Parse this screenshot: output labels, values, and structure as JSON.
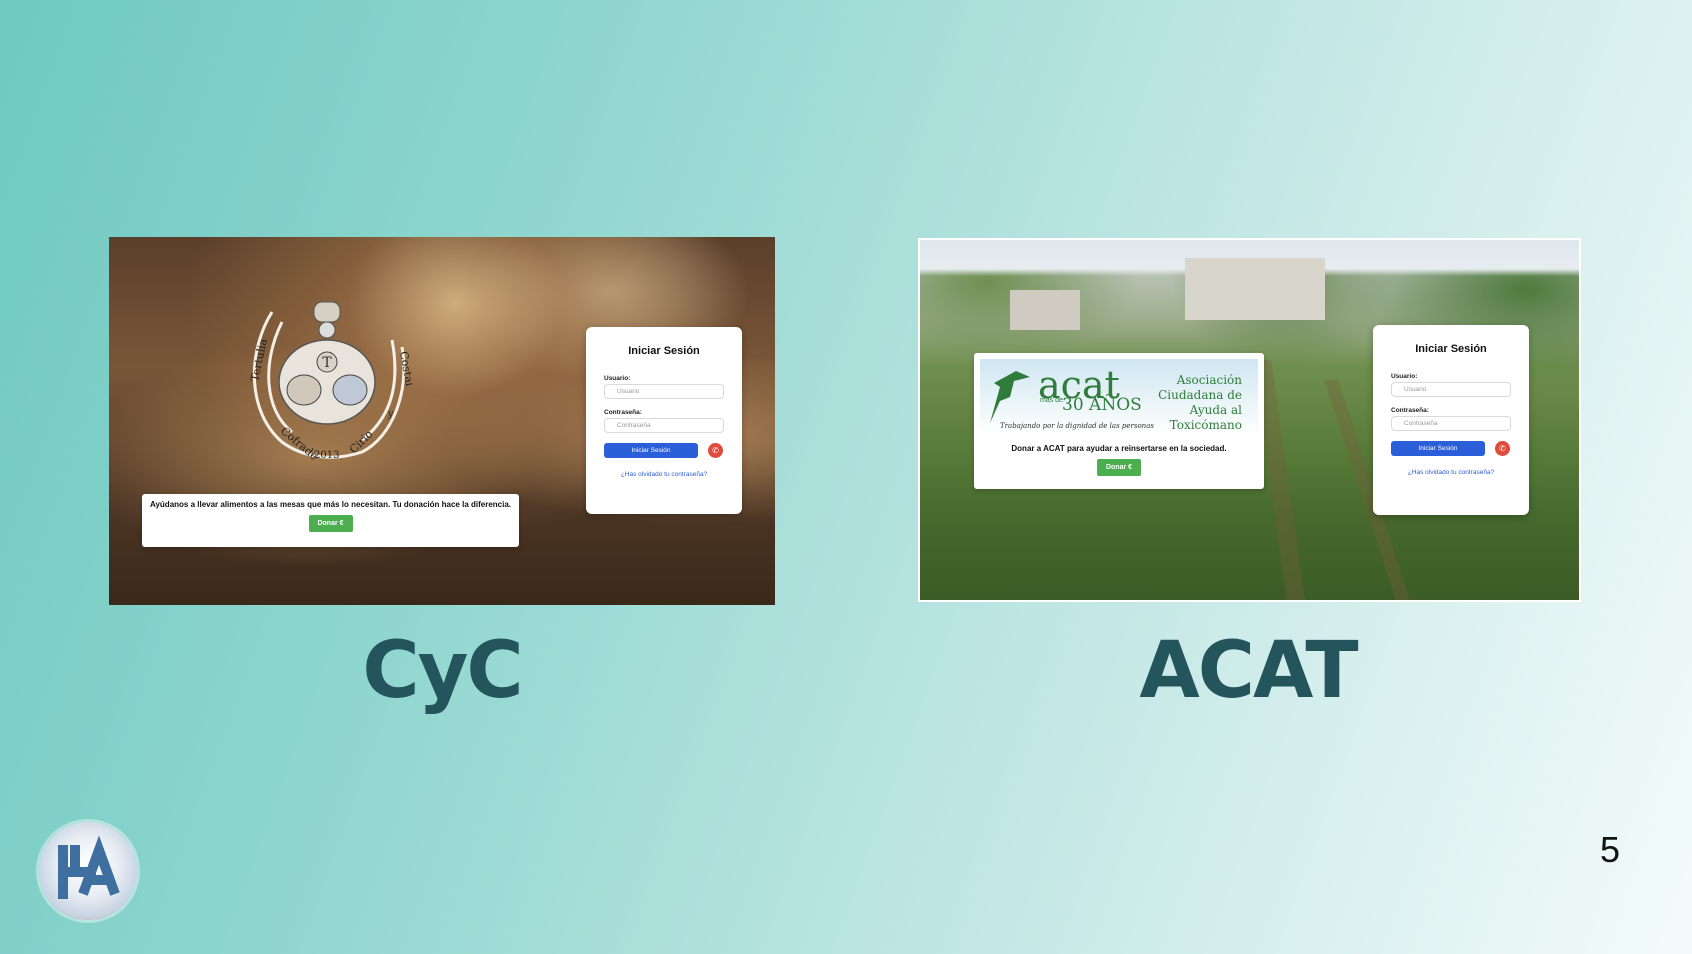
{
  "slide": {
    "page_number": "5"
  },
  "cyc": {
    "caption": "CyC",
    "crest_text": [
      "Tertulia",
      "Cofrade",
      "2013",
      "Cirio",
      "y",
      "Costal"
    ],
    "login": {
      "title": "Iniciar Sesión",
      "user_label": "Usuario:",
      "user_placeholder": "Usuario",
      "password_label": "Contraseña:",
      "password_placeholder": "Contraseña",
      "submit_label": "Iniciar Sesión",
      "forgot_link": "¿Has olvidado tu contraseña?"
    },
    "donate": {
      "text": "Ayúdanos a llevar alimentos a las mesas que más lo necesitan. Tu donación hace la diferencia.",
      "button_label": "Donar €"
    }
  },
  "acat": {
    "caption": "ACAT",
    "banner": {
      "brand": "acat",
      "more_than": "más de",
      "years": "30 AÑOS",
      "organization": [
        "Asociación",
        "Ciudadana de",
        "Ayuda al",
        "Toxicómano"
      ],
      "motto": "Trabajando por la dignidad de las personas"
    },
    "login": {
      "title": "Iniciar Sesión",
      "user_label": "Usuario:",
      "user_placeholder": "Usuario",
      "password_label": "Contraseña:",
      "password_placeholder": "Contraseña",
      "submit_label": "Iniciar Sesión",
      "forgot_link": "¿Has olvidado tu contraseña?"
    },
    "donate": {
      "text": "Donar a ACAT para ayudar a reinsertarse en la sociedad.",
      "button_label": "Donar €"
    }
  },
  "colors": {
    "caption": "#24555d",
    "primary_button": "#2b5fd9",
    "donate_button": "#4cae4f",
    "phone_button": "#e04b3c",
    "acat_green": "#2e7d3a"
  },
  "icons": {
    "phone": "phone-icon",
    "logo": "ha-logo"
  }
}
